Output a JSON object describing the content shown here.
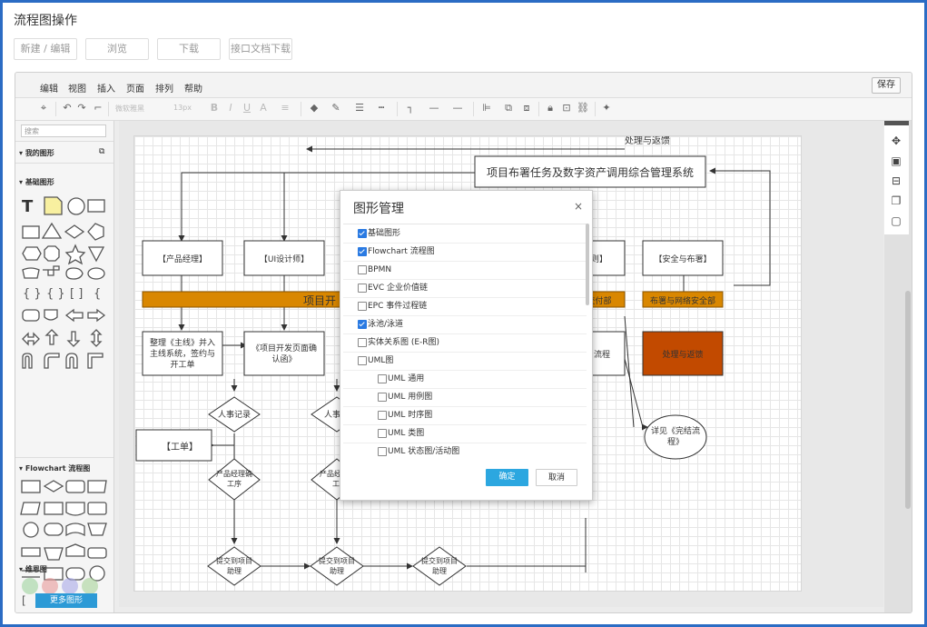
{
  "page": {
    "title": "流程图操作"
  },
  "actions": {
    "new_edit": "新建 / 编辑",
    "browse": "浏览",
    "download": "下载",
    "api_doc": "接口文档下载"
  },
  "menu": {
    "edit": "编辑",
    "view": "视图",
    "insert": "插入",
    "page": "页面",
    "arrange": "排列",
    "help": "帮助",
    "save": "保存"
  },
  "toolbar": {
    "font": "微软雅黑",
    "font_size": "13px"
  },
  "sidebar": {
    "search_placeholder": "搜索",
    "sections": {
      "my_shapes": "我的图形",
      "basic": "基础图形",
      "flowchart": "Flowchart 流程图",
      "mindmap": "维恩图"
    },
    "more_button": "更多图形"
  },
  "diagram": {
    "top_label": "处理与返馈",
    "main_title": "项目布署任务及数字资产调用综合管理系统",
    "box_pm": "【产品经理】",
    "box_ui": "【UI设计师】",
    "box_right1": "则】",
    "box_security": "【安全与布署】",
    "bar_main": "项目开",
    "bar_dept": "交付部",
    "bar_network": "布署与网络安全部",
    "box_organize": "整理《主线》并入主线系统，签约与开工单",
    "box_page_confirm": "《项目开发页面确认函》",
    "box_flow": "流程",
    "box_process_feedback": "处理与返馈",
    "oval_detail": "详见《完结流程》",
    "box_ticket": "【工单】",
    "diamond_hr1": "人事记录",
    "diamond_hr2": "人事",
    "diamond_pm_confirm": "产品经理确认工序",
    "diamond_pm_confirm2": "产品经工",
    "diamond_submit1": "提交到项目助理",
    "diamond_submit2": "提交到项目助理",
    "diamond_submit3": "提交到项目助理"
  },
  "modal": {
    "title": "图形管理",
    "items": [
      {
        "label": "基础图形",
        "checked": true
      },
      {
        "label": "Flowchart 流程图",
        "checked": true
      },
      {
        "label": "BPMN",
        "checked": false
      },
      {
        "label": "EVC 企业价值链",
        "checked": false
      },
      {
        "label": "EPC 事件过程链",
        "checked": false
      },
      {
        "label": "泳池/泳道",
        "checked": true
      },
      {
        "label": "实体关系图 (E-R图)",
        "checked": false
      },
      {
        "label": "UML图",
        "checked": false
      },
      {
        "label": "UML 通用",
        "checked": false
      },
      {
        "label": "UML 用例图",
        "checked": false
      },
      {
        "label": "UML 时序图",
        "checked": false
      },
      {
        "label": "UML 类图",
        "checked": false
      },
      {
        "label": "UML 状态图/活动图",
        "checked": false
      }
    ],
    "ok": "确定",
    "cancel": "取消"
  },
  "colors": {
    "accent_blue": "#2ca7e0",
    "frame_border": "#2b6cc4",
    "orange": "#d98700",
    "dark_orange": "#c24a00"
  }
}
